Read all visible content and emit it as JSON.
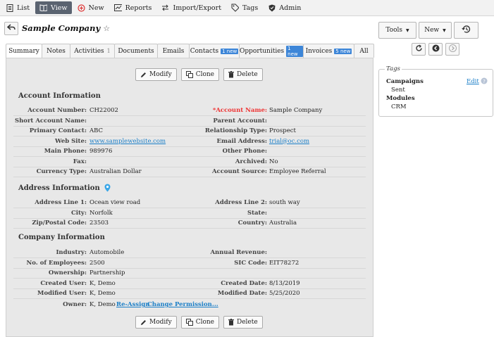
{
  "toolbar": {
    "items": [
      {
        "label": "List",
        "icon": "document-icon"
      },
      {
        "label": "View",
        "icon": "book-icon",
        "active": true
      },
      {
        "label": "New",
        "icon": "plus-circle-icon"
      },
      {
        "label": "Reports",
        "icon": "chart-icon"
      },
      {
        "label": "Import/Export",
        "icon": "arrows-icon"
      },
      {
        "label": "Tags",
        "icon": "tag-icon"
      },
      {
        "label": "Admin",
        "icon": "shield-icon"
      }
    ]
  },
  "header": {
    "title": "Sample Company",
    "star": "☆"
  },
  "tabs": [
    {
      "label": "Summary",
      "active": true
    },
    {
      "label": "Notes"
    },
    {
      "label": "Activities",
      "count": "1"
    },
    {
      "label": "Documents"
    },
    {
      "label": "Emails"
    },
    {
      "label": "Contacts",
      "badge": "1 new"
    },
    {
      "label": "Opportunities",
      "badge": "1 new"
    },
    {
      "label": "Invoices",
      "badge": "5 new"
    },
    {
      "label": "All"
    }
  ],
  "actions": {
    "modify": "Modify",
    "clone": "Clone",
    "delete": "Delete"
  },
  "sections": {
    "account": "Account Information",
    "address": "Address Information",
    "company": "Company Information"
  },
  "account_rows": [
    {
      "l1": "Account Number:",
      "v1": "CH22002",
      "l2": "*Account Name:",
      "v2": "Sample Company",
      "req2": true
    },
    {
      "l1": "Short Account Name:",
      "v1": "",
      "l2": "Parent Account:",
      "v2": ""
    },
    {
      "l1": "Primary Contact:",
      "v1": "ABC",
      "l2": "Relationship Type:",
      "v2": "Prospect"
    },
    {
      "l1": "Web Site:",
      "v1": "www.samplewebsite.com",
      "link1": true,
      "l2": "Email Address:",
      "v2": "trial@oc.com",
      "link2": true
    },
    {
      "l1": "Main Phone:",
      "v1": "989976",
      "l2": "Other Phone:",
      "v2": ""
    },
    {
      "l1": "Fax:",
      "v1": "",
      "l2": "Archived:",
      "v2": "No"
    },
    {
      "l1": "Currency Type:",
      "v1": "Australian Dollar",
      "l2": "Account Source:",
      "v2": "Employee Referral"
    }
  ],
  "address_rows": [
    {
      "l1": "Address Line 1:",
      "v1": "Ocean view road",
      "l2": "Address Line 2:",
      "v2": "south way"
    },
    {
      "l1": "City:",
      "v1": "Norfolk",
      "l2": "State:",
      "v2": ""
    },
    {
      "l1": "Zip/Postal Code:",
      "v1": "23503",
      "l2": "Country:",
      "v2": "Australia"
    }
  ],
  "company_rows": [
    {
      "l1": "Industry:",
      "v1": "Automobile",
      "l2": "Annual Revenue:",
      "v2": ""
    },
    {
      "l1": "No. of Employees:",
      "v1": "2500",
      "l2": "SIC Code:",
      "v2": "EIT78272"
    },
    {
      "l1": "Ownership:",
      "v1": "Partnership",
      "l2": "",
      "v2": ""
    },
    {
      "l1": "Created User:",
      "v1": "K, Demo",
      "l2": "Created Date:",
      "v2": "8/13/2019"
    },
    {
      "l1": "Modified User:",
      "v1": "K, Demo",
      "l2": "Modified Date:",
      "v2": "5/25/2020"
    }
  ],
  "owner": {
    "label": "Owner:",
    "value": "K, Demo",
    "reassign": "Re-Assign",
    "change_perm": "Change Permission..."
  },
  "right": {
    "tools": "Tools",
    "new": "New",
    "tags_title": "Tags",
    "campaigns": "Campaigns",
    "campaign_value": "Sent",
    "modules": "Modules",
    "module_value": "CRM",
    "edit": "Edit"
  }
}
